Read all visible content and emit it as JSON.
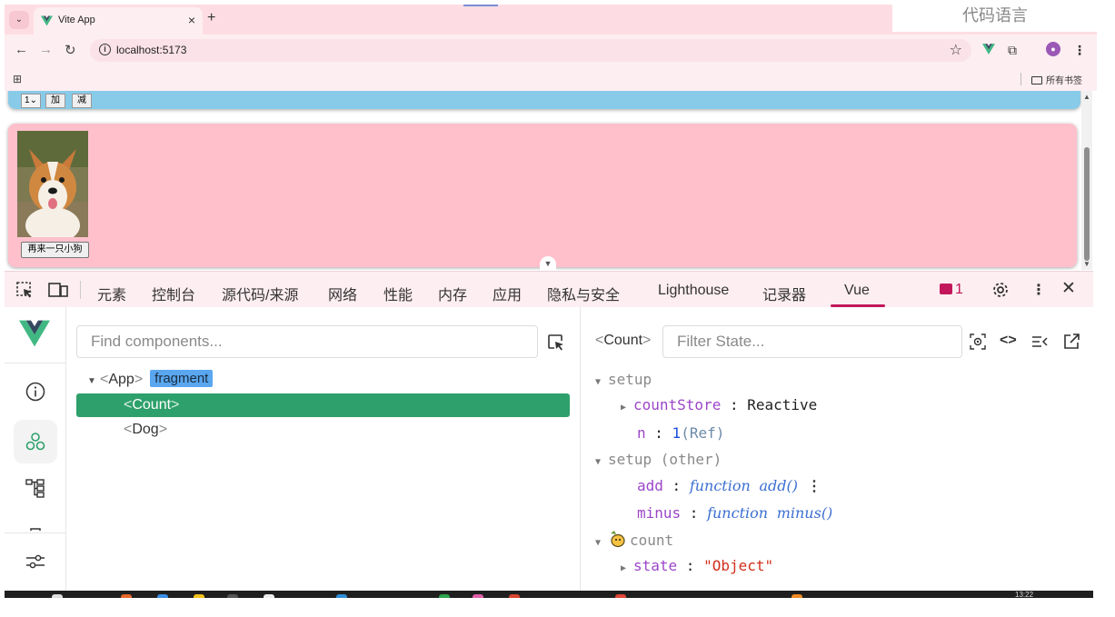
{
  "browser": {
    "tab_title": "Vite App",
    "tab_close": "×",
    "new_tab": "+",
    "url": "localhost:5173",
    "bookmarks_all": "所有书签",
    "watermark": "代码语言"
  },
  "page": {
    "count_select_value": "1",
    "count_add_label": "加",
    "count_minus_label": "减",
    "dog_button_label": "再来一只小狗",
    "card_colors": {
      "count_card": "#87cbe8",
      "dog_card": "#ffc0cb"
    }
  },
  "devtools": {
    "tabs": [
      "元素",
      "控制台",
      "源代码/来源",
      "网络",
      "性能",
      "内存",
      "应用",
      "隐私与安全",
      "Lighthouse",
      "记录器",
      "Vue"
    ],
    "active_tab": "Vue",
    "issues_count": "1",
    "accent": "#c2185b"
  },
  "vue": {
    "search_placeholder": "Find components...",
    "tree": {
      "app": "App",
      "fragment_badge": "fragment",
      "count": "Count",
      "dog": "Dog"
    },
    "selected_component": "Count",
    "filter_placeholder": "Filter State...",
    "state": {
      "setup_label": "setup",
      "count_store_key": "countStore",
      "count_store_value": "Reactive",
      "n_key": "n",
      "n_value": "1",
      "n_meta": "(Ref)",
      "setup_other_label": "setup (other)",
      "add_key": "add",
      "add_kw": "function",
      "add_value": "add()",
      "minus_key": "minus",
      "minus_kw": "function",
      "minus_value": "minus()",
      "store_label": "count",
      "state_key": "state",
      "state_value": "\"Object\""
    },
    "selected_color": "#2ea06b"
  },
  "taskbar": {
    "clock": "13:22"
  }
}
